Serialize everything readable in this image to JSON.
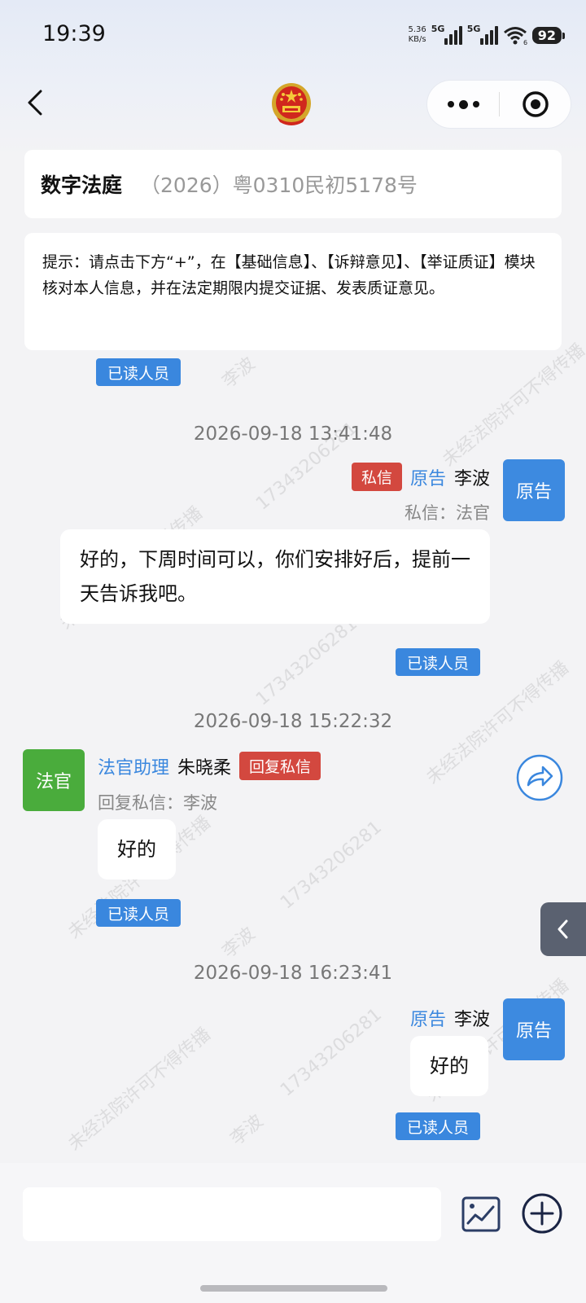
{
  "status_bar": {
    "time": "19:39",
    "net_speed_value": "5.36",
    "net_speed_unit": "KB/s",
    "signal1_label": "5G",
    "signal2_label": "5G",
    "wifi_sub": "6",
    "battery": "92"
  },
  "nav": {
    "back_icon": "chevron-left-icon",
    "emblem": "national-emblem-icon",
    "more_icon": "more-dots-icon",
    "target_icon": "close-target-icon"
  },
  "header": {
    "title": "数字法庭",
    "case_number": "（2026）粤0310民初5178号"
  },
  "notice": {
    "text": "提示：请点击下方“+”，在【基础信息】、【诉辩意见】、【举证质证】模块核对本人信息，并在法定期限内提交证据、发表质证意见。"
  },
  "watermark": {
    "court_text": "未经法院许可不得传播",
    "phone": "17343206281",
    "name": "李波"
  },
  "messages": {
    "top_read_label": "已读人员",
    "m1": {
      "timestamp": "2026-09-18 13:41:48",
      "private_tag": "私信",
      "role": "原告",
      "name": "李波",
      "avatar_label": "原告",
      "sub_line": "私信：法官",
      "text": "好的，下周时间可以，你们安排好后，提前一天告诉我吧。",
      "read_label": "已读人员"
    },
    "m2": {
      "timestamp": "2026-09-18 15:22:32",
      "avatar_label": "法官",
      "role": "法官助理",
      "name": "朱晓柔",
      "reply_tag": "回复私信",
      "sub_line": "回复私信：李波",
      "text": "好的",
      "read_label": "已读人员"
    },
    "m3": {
      "timestamp": "2026-09-18 16:23:41",
      "role": "原告",
      "name": "李波",
      "avatar_label": "原告",
      "text": "好的",
      "read_label": "已读人员"
    }
  },
  "bottom": {
    "input_placeholder": "",
    "image_icon": "image-icon",
    "plus_icon": "plus-circle-icon"
  },
  "colors": {
    "accent_blue": "#3a87de",
    "tag_red": "#d3483f",
    "judge_green": "#4aac3c"
  }
}
